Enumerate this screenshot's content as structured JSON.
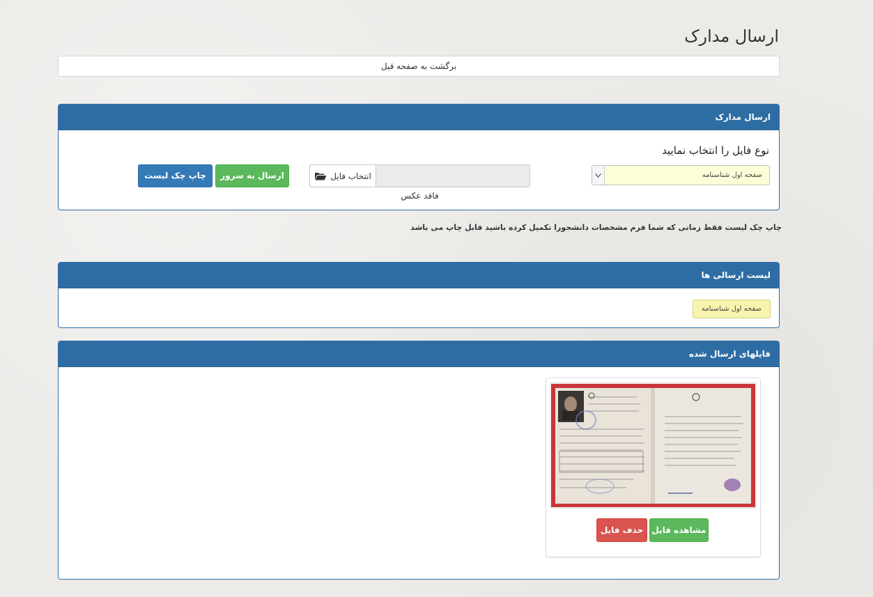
{
  "page": {
    "title": "ارسال مدارک"
  },
  "back": {
    "label": "برگشت به صفحه قبل"
  },
  "upload_panel": {
    "heading": "ارسال مدارک",
    "select_title": "نوع فایل را انتخاب نمایید",
    "select_value": "صفحه اول شناسنامه",
    "choose_file_label": "انتخاب فایل",
    "file_status": "فاقد عکس",
    "send_label": "ارسال به سرور",
    "print_label": "چاپ چک لیست"
  },
  "note": "چاپ چک لیست فقط زمانی که شما فرم مشخصات دانشجورا تکمیل کرده باشید قابل چاپ می باشد",
  "list_panel": {
    "heading": "لیست ارسالی ها",
    "items": [
      "صفحه اول شناسنامه"
    ]
  },
  "files_panel": {
    "heading": "فایلهای ارسال شده",
    "view_label": "مشاهده فایل",
    "delete_label": "حذف فایل"
  },
  "colors": {
    "panel_heading": "#2e6da4",
    "green": "#5cb85c",
    "blue": "#337ab7",
    "red": "#d9534f",
    "select_bg": "#fdfdd8",
    "chip_bg": "#f7f4ad"
  },
  "icons": {
    "choose_file": "folder-open-icon",
    "select_arrow": "chevron-down-icon"
  }
}
